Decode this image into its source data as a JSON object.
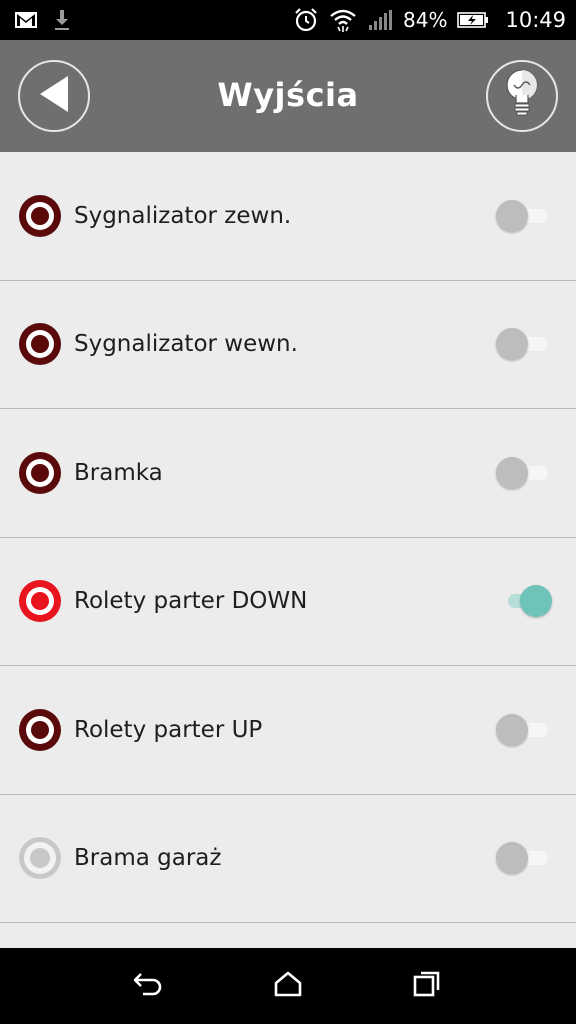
{
  "status_bar": {
    "battery": "84%",
    "time": "10:49",
    "icons": [
      "gmail-icon",
      "download-icon",
      "alarm-icon",
      "wifi-icon",
      "signal-icon",
      "battery-charging-icon"
    ]
  },
  "header": {
    "title": "Wyjścia",
    "back_icon": "back-arrow-icon",
    "action_icon": "lightbulb-icon",
    "background_color": "#6f6f6f"
  },
  "outputs": [
    {
      "label": "Sygnalizator zewn.",
      "active": false,
      "indicator": "dark-red"
    },
    {
      "label": "Sygnalizator wewn.",
      "active": false,
      "indicator": "dark-red"
    },
    {
      "label": "Bramka",
      "active": false,
      "indicator": "dark-red"
    },
    {
      "label": "Rolety parter DOWN",
      "active": true,
      "indicator": "bright-red"
    },
    {
      "label": "Rolety parter UP",
      "active": false,
      "indicator": "dark-red"
    },
    {
      "label": "Brama garaż",
      "active": false,
      "indicator": "gray"
    }
  ],
  "colors": {
    "toggle_on": "#6fc4ba",
    "indicator_dark": "#5a0a0a",
    "indicator_active": "#e8141e",
    "indicator_gray": "#c8c8c8"
  },
  "navbar": {
    "icons": [
      "back-nav-icon",
      "home-nav-icon",
      "recents-nav-icon"
    ]
  }
}
